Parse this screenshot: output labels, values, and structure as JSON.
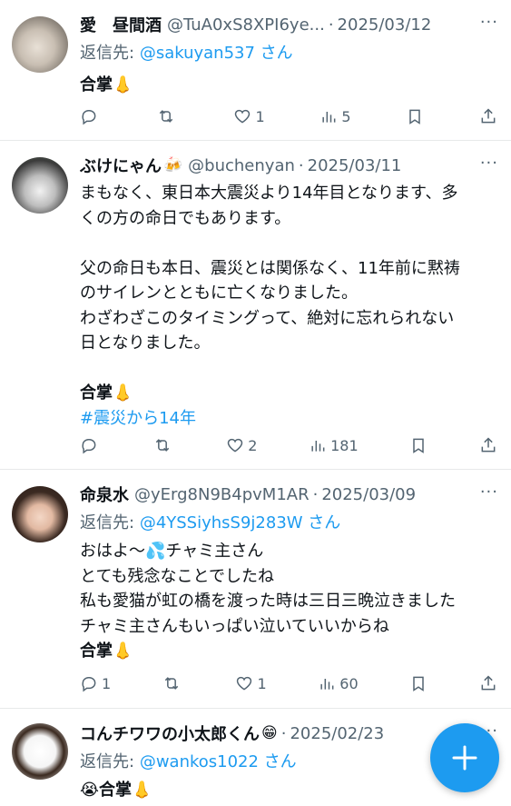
{
  "tweets": [
    {
      "name": "愛　昼間酒",
      "name_emoji": "",
      "handle": "@TuA0xS8XPI6ye...",
      "date": "2025/03/12",
      "reply_prefix": "返信先:",
      "reply_to": "@sakuyan537 さん",
      "body": [
        "合掌👃"
      ],
      "counts": {
        "reply": "",
        "retweet": "",
        "like": "1",
        "views": "5"
      }
    },
    {
      "name": "ぶけにゃん",
      "name_emoji": "🍻",
      "handle": "@buchenyan",
      "date": "2025/03/11",
      "body": [
        "まもなく、東日本大震災より14年目となります、多",
        "くの方の命日でもあります。",
        "",
        "父の命日も本日、震災とは関係なく、11年前に黙祷",
        "のサイレンとともに亡くなりました。",
        "わざわざこのタイミングって、絶対に忘れられない",
        "日となりました。",
        "",
        "合掌👃"
      ],
      "hashtag": "#震災から14年",
      "counts": {
        "reply": "",
        "retweet": "",
        "like": "2",
        "views": "181"
      }
    },
    {
      "name": "命泉水",
      "name_emoji": "",
      "handle": "@yErg8N9B4pvM1AR",
      "date": "2025/03/09",
      "reply_prefix": "返信先:",
      "reply_to": "@4YSSiyhsS9j283W さん",
      "body": [
        "おはよ～💦チャミ主さん",
        "とても残念なことでしたね",
        "私も愛猫が虹の橋を渡った時は三日三晩泣きました",
        "チャミ主さんもいっぱい泣いていいからね",
        "合掌👃"
      ],
      "counts": {
        "reply": "1",
        "retweet": "",
        "like": "1",
        "views": "60"
      }
    },
    {
      "name": "コんチワワの小太郎くん",
      "name_emoji": "😁",
      "handle": "",
      "date": "2025/02/23",
      "reply_prefix": "返信先:",
      "reply_to": "@wankos1022 さん",
      "body": [
        "😭合掌👃"
      ]
    }
  ],
  "more_label": "···",
  "colors": {
    "accent": "#1d9bf0",
    "muted": "#536471",
    "text": "#0f1419"
  },
  "fab_icon": "plus-icon"
}
